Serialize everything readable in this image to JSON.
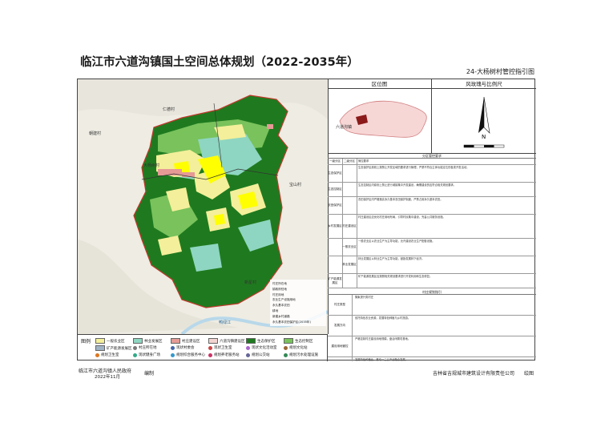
{
  "title": "临江市六道沟镇国土空间总体规划（2022-2035年）",
  "sheet_title": "24-大杨树村管控指引图",
  "panels": {
    "location_map": "区位图",
    "wind_rose": "风玫瑰与比例尺",
    "location_town_label": "六道沟镇"
  },
  "map_labels": {
    "renhe": "仁德村",
    "dongjian": "朝建村",
    "dayangshu": "大杨树村",
    "baoshan": "宝山村",
    "xinqiao": "新星村",
    "yalujiang": "鸭绿江"
  },
  "map_legend_right": [
    "村庄所在地",
    "镇政府驻地",
    "村庄用地",
    "农业生产设施用地",
    "永久基本农田",
    "耕地",
    "新建乡村道路",
    "永久基本农田保护区(2035年)"
  ],
  "legend": {
    "title": "图例",
    "items": [
      {
        "label": "一般农业区",
        "color": "#f4ef9a"
      },
      {
        "label": "林业发展区",
        "color": "#8ed6c1"
      },
      {
        "label": "村庄建设区",
        "color": "#e59a96"
      },
      {
        "label": "六道沟镇建设区",
        "color": "#f2d3d0"
      },
      {
        "label": "生态保护区",
        "color": "#1f7a1f"
      },
      {
        "label": "生态控制区",
        "color": "#79c25c"
      },
      {
        "label": "矿产能源发展区",
        "color": "#a0b3c5"
      },
      {
        "label": "村庄所在地",
        "color": "#7a7a7a"
      },
      {
        "label": "现状村委会",
        "color": "#4466aa"
      },
      {
        "label": "现状卫生室",
        "color": "#cc4444"
      },
      {
        "label": "现状文化活动室",
        "color": "#aa66cc"
      },
      {
        "label": "规划文化站",
        "color": "#996633"
      },
      {
        "label": "规划卫生室",
        "color": "#dd7722"
      },
      {
        "label": "现状健身广场",
        "color": "#33aa88"
      },
      {
        "label": "规划综合服务中心",
        "color": "#3399cc"
      },
      {
        "label": "规划养老服务站",
        "color": "#cc3366"
      },
      {
        "label": "规划公交站",
        "color": "#666699"
      },
      {
        "label": "规划污水处理设施",
        "color": "#338855"
      }
    ]
  },
  "table": {
    "section1": "分区管控要求",
    "rows": [
      {
        "c1": "一级分区",
        "c2": "二级分区",
        "text": "管控要求"
      },
      {
        "c1": "生态保护区",
        "c2": "",
        "text": "生态保护区原则上按禁止开发区域的要求进行管理，严禁不符合主体功能定位的各类开发活动。"
      },
      {
        "c1": "生态控制区",
        "c2": "",
        "text": "生态控制区内原则上禁止进行城镇集中开发建设，确需建设的应符合相关规划要求。"
      },
      {
        "c1": "农田保护区",
        "c2": "",
        "text": "农田保护区内严格落实永久基本农田保护制度，严禁占用永久基本农田。"
      },
      {
        "c1": "乡村发展区",
        "c2": "村庄建设区",
        "text": "村庄建设区应优化村庄用地布局，引导村民集中建设，完善公共服务设施。"
      },
      {
        "c1": "",
        "c2": "一般农业区",
        "text": "一般农业区以农业生产为主导功能，允许建设农业生产配套设施。"
      },
      {
        "c1": "",
        "c2": "林业发展区",
        "text": "林业发展区以林业生产为主导功能，鼓励发展林下经济。"
      },
      {
        "c1": "矿产能源发展区",
        "c2": "",
        "text": "矿产能源发展区应按照相关规划要求进行开发利用和生态修复。"
      }
    ],
    "section2": "村庄规划指引",
    "rows2": [
      {
        "c1": "村庄类型",
        "text": "集聚提升类村庄"
      },
      {
        "c1": "发展方向",
        "text": "依托特色农业资源，发展特色种植与乡村旅游。"
      },
      {
        "c1": "建设用地管控",
        "text": "严格控制村庄建设用地规模，盘活闲置宅基地。"
      },
      {
        "c1": "产业发展",
        "text": "发展特色种植业，推动一二三产业融合发展。"
      },
      {
        "c1": "设施配置",
        "text": "完善村委会、卫生室、文化活动室等公共服务设施。"
      },
      {
        "c1": "风貌管控",
        "text": "延续传统村落风貌，协调新建建筑与周边环境。"
      }
    ],
    "stats_head": [
      "村庄名称",
      "村庄类型",
      "村域面积",
      "户籍人口",
      "主导产业",
      "建设用地"
    ],
    "stats_row": [
      "大杨树村",
      "集聚提升类",
      "—",
      "—",
      "特色种植",
      "—"
    ]
  },
  "footer": {
    "issuer": "临江市六道沟镇人民政府",
    "date": "2022年11月",
    "compile_label": "编制",
    "drafter": "吉林省吉规城市建筑设计有限责任公司",
    "draw_label": "绘图"
  }
}
